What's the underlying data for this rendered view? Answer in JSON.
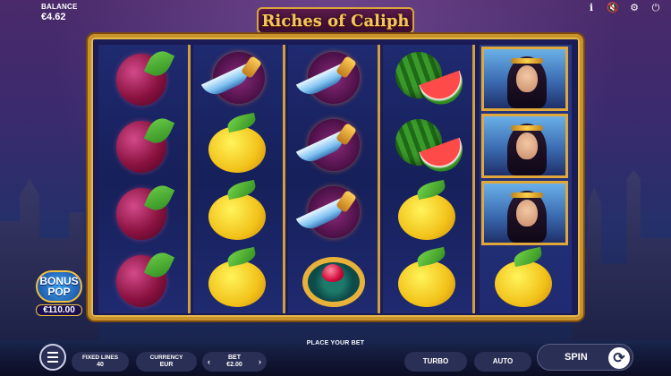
{
  "header": {
    "balance_label": "BALANCE",
    "balance_value": "€4.62",
    "game_title": "Riches of Caliph",
    "icons": [
      "info-icon",
      "sound-off-icon",
      "settings-icon",
      "power-icon"
    ]
  },
  "reels": [
    [
      "plum",
      "plum",
      "plum",
      "plum"
    ],
    [
      "dagger",
      "lemon",
      "lemon",
      "lemon"
    ],
    [
      "dagger",
      "dagger",
      "dagger",
      "ring"
    ],
    [
      "watermelon",
      "watermelon",
      "lemon",
      "lemon"
    ],
    [
      "princess",
      "princess",
      "princess",
      "lemon"
    ]
  ],
  "bonus": {
    "title_line1": "BONUS",
    "title_line2": "POP",
    "value": "€110.00"
  },
  "status_message": "PLACE YOUR BET",
  "controls": {
    "fixed_lines_label": "FIXED LINES",
    "fixed_lines_value": "40",
    "currency_label": "CURRENCY",
    "currency_value": "EUR",
    "bet_label": "BET",
    "bet_value": "€2.00",
    "turbo_label": "TURBO",
    "auto_label": "AUTO",
    "spin_label": "SPIN"
  },
  "colors": {
    "frame_gold": "#c9932c",
    "reel_bg": "#1b1b55",
    "control_bg": "#2a2f55"
  }
}
